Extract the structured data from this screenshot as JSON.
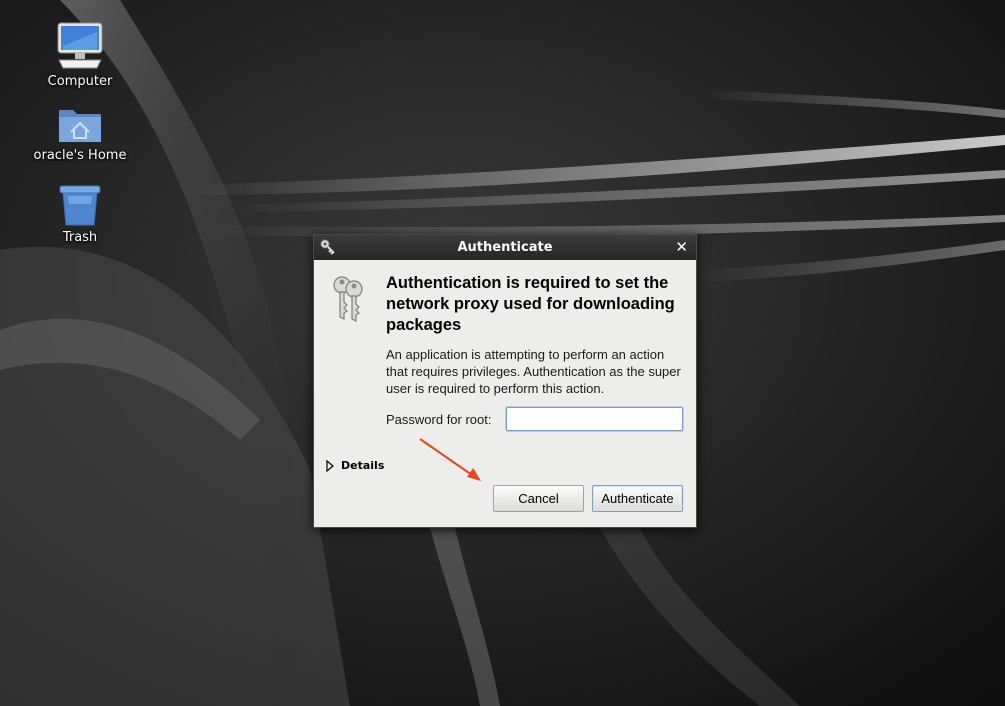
{
  "desktop": {
    "icons": [
      {
        "label": "Computer",
        "icon": "computer-icon"
      },
      {
        "label": "oracle's Home",
        "icon": "home-folder-icon"
      },
      {
        "label": "Trash",
        "icon": "trash-icon"
      }
    ]
  },
  "dialog": {
    "title": "Authenticate",
    "close_glyph": "✕",
    "heading": "Authentication is required to set the network proxy used for downloading packages",
    "body": "An application is attempting to perform an action that requires privileges. Authentication as the super user is required to perform this action.",
    "password_label": "Password for root:",
    "password_value": "",
    "details_label": "Details",
    "cancel_label": "Cancel",
    "authenticate_label": "Authenticate",
    "icon": "keys-icon"
  },
  "annotation": {
    "color": "#e8491c"
  },
  "colors": {
    "titlebar": "#2f2f2f",
    "dialog_bg": "#ededeb",
    "focus": "#7a9cc7"
  }
}
